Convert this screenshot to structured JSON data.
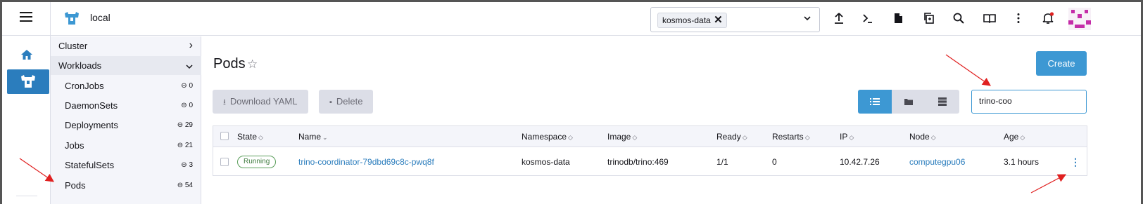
{
  "header": {
    "cluster_name": "local",
    "namespace_chip": "kosmos-data",
    "namespace_chip_remove": "✕",
    "icons": [
      "menu-icon",
      "import-yaml-icon",
      "kubectl-shell-icon",
      "kubeconfig-icon",
      "copy-kubeconfig-icon",
      "search-icon",
      "docs-icon",
      "more-icon",
      "notifications-icon"
    ],
    "notification_dot_color": "#e02020"
  },
  "sidebar": {
    "groups": [
      {
        "label": "Cluster",
        "chevron": "›"
      },
      {
        "label": "Workloads",
        "chevron": "⌄"
      }
    ],
    "items": [
      {
        "label": "CronJobs",
        "count": "0"
      },
      {
        "label": "DaemonSets",
        "count": "0"
      },
      {
        "label": "Deployments",
        "count": "29"
      },
      {
        "label": "Jobs",
        "count": "21"
      },
      {
        "label": "StatefulSets",
        "count": "3"
      },
      {
        "label": "Pods",
        "count": "54"
      }
    ],
    "count_prefix": "⊖"
  },
  "main": {
    "title": "Pods",
    "star": "☆",
    "create_label": "Create",
    "download_yaml_label": "Download YAML",
    "delete_label": "Delete",
    "search_value": "trino-coo",
    "view_modes": [
      "flat-list-icon",
      "group-by-namespace-icon",
      "group-by-node-icon"
    ]
  },
  "table": {
    "headers": [
      "State",
      "Name",
      "Namespace",
      "Image",
      "Ready",
      "Restarts",
      "IP",
      "Node",
      "Age"
    ],
    "sort_glyph": "◇",
    "rows": [
      {
        "state": "Running",
        "name": "trino-coordinator-79dbd69c8c-pwq8f",
        "namespace": "kosmos-data",
        "image": "trinodb/trino:469",
        "ready": "1/1",
        "restarts": "0",
        "ip": "10.42.7.26",
        "node": "computegpu06",
        "age": "3.1 hours",
        "actions": "⋮"
      }
    ]
  },
  "colors": {
    "accent": "#3d98d3",
    "rail_active": "#2b7dbd",
    "link": "#2b7dbd",
    "running": "#5a9e5a",
    "annotation_arrow": "#e02020"
  }
}
